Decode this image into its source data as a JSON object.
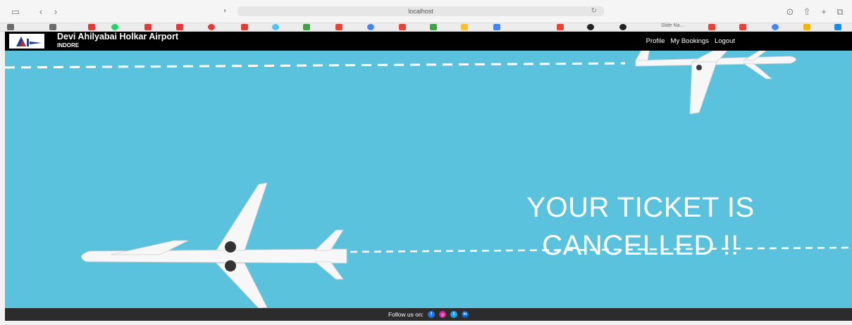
{
  "browser": {
    "url": "localhost",
    "bookmark_tab_label": "Slide Na..."
  },
  "site": {
    "brand_title": "Devi Ahilyabai Holkar Airport",
    "brand_subtitle": "INDORE",
    "nav": [
      {
        "label": "Profile"
      },
      {
        "label": "My Bookings"
      },
      {
        "label": "Logout"
      }
    ]
  },
  "hero": {
    "message_line1": "YOUR TICKET IS",
    "message_line2": "CANCELLED !!",
    "background_color": "#5bc2de"
  },
  "footer": {
    "label": "Follow us on:",
    "social": [
      {
        "name": "facebook",
        "icon": "facebook-icon",
        "color": "#1877f2",
        "glyph": "f"
      },
      {
        "name": "instagram",
        "icon": "instagram-icon",
        "color": "#d6249f",
        "glyph": "◎"
      },
      {
        "name": "twitter",
        "icon": "twitter-icon",
        "color": "#1da1f2",
        "glyph": "t"
      },
      {
        "name": "linkedin",
        "icon": "linkedin-icon",
        "color": "#0a66c2",
        "glyph": "in"
      }
    ]
  }
}
